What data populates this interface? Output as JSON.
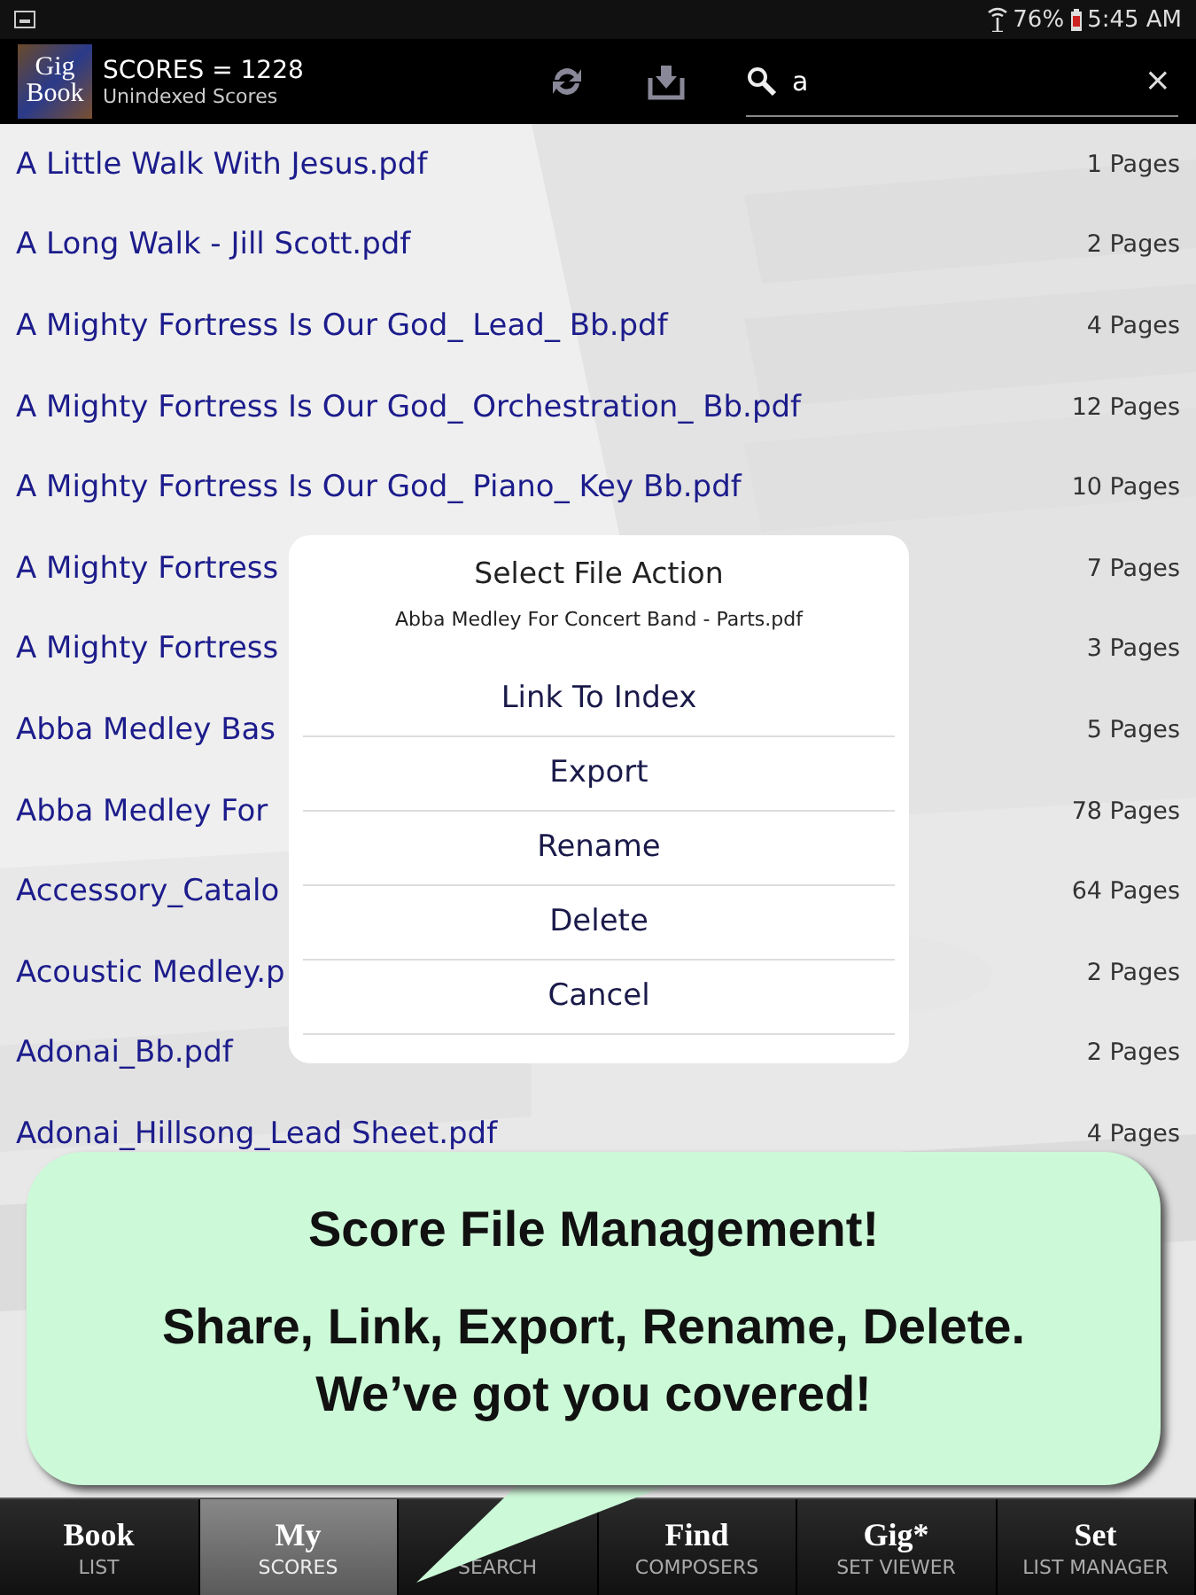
{
  "status_bar": {
    "battery": "76%",
    "time": "5:45 AM"
  },
  "app_bar": {
    "logo": [
      "Gig",
      "Book"
    ],
    "title": "SCORES = 1228",
    "subtitle": "Unindexed Scores",
    "search": {
      "value": "a",
      "clear": "×"
    }
  },
  "files": [
    {
      "name": "A Little Walk With Jesus.pdf",
      "pages": "1 Pages"
    },
    {
      "name": "A Long Walk - Jill Scott.pdf",
      "pages": "2 Pages"
    },
    {
      "name": "A Mighty Fortress Is Our God_ Lead_ Bb.pdf",
      "pages": "4 Pages"
    },
    {
      "name": "A Mighty Fortress Is Our God_ Orchestration_ Bb.pdf",
      "pages": "12 Pages"
    },
    {
      "name": "A Mighty Fortress Is Our God_ Piano_ Key Bb.pdf",
      "pages": "10 Pages"
    },
    {
      "name": "A Mighty Fortress",
      "pages": "7 Pages"
    },
    {
      "name": "A Mighty Fortress",
      "pages": "3 Pages"
    },
    {
      "name": "Abba Medley Bas",
      "pages": "5 Pages"
    },
    {
      "name": "Abba Medley For",
      "pages": "78 Pages"
    },
    {
      "name": "Accessory_Catalo",
      "pages": "64 Pages"
    },
    {
      "name": "Acoustic Medley.p",
      "pages": "2 Pages"
    },
    {
      "name": "Adonai_Bb.pdf",
      "pages": "2 Pages"
    },
    {
      "name": "Adonai_Hillsong_Lead Sheet.pdf",
      "pages": "4 Pages"
    }
  ],
  "dialog": {
    "title": "Select File Action",
    "file": "Abba Medley For Concert Band - Parts.pdf",
    "actions": [
      "Link To Index",
      "Export",
      "Rename",
      "Delete",
      "Cancel"
    ]
  },
  "callout": {
    "heading": "Score File Management!",
    "lines": [
      "Share, Link, Export, Rename, Delete.",
      "We’ve got you covered!"
    ]
  },
  "tabs": [
    {
      "title": "Book",
      "subtitle": "LIST",
      "selected": false
    },
    {
      "title": "My",
      "subtitle": "SCORES",
      "selected": true
    },
    {
      "subtitle": "SEARCH",
      "selected": false
    },
    {
      "title": "Find",
      "subtitle": "COMPOSERS",
      "selected": false
    },
    {
      "title": "Gig*",
      "subtitle": "SET VIEWER",
      "selected": false
    },
    {
      "title": "Set",
      "subtitle": "LIST MANAGER",
      "selected": false
    }
  ]
}
